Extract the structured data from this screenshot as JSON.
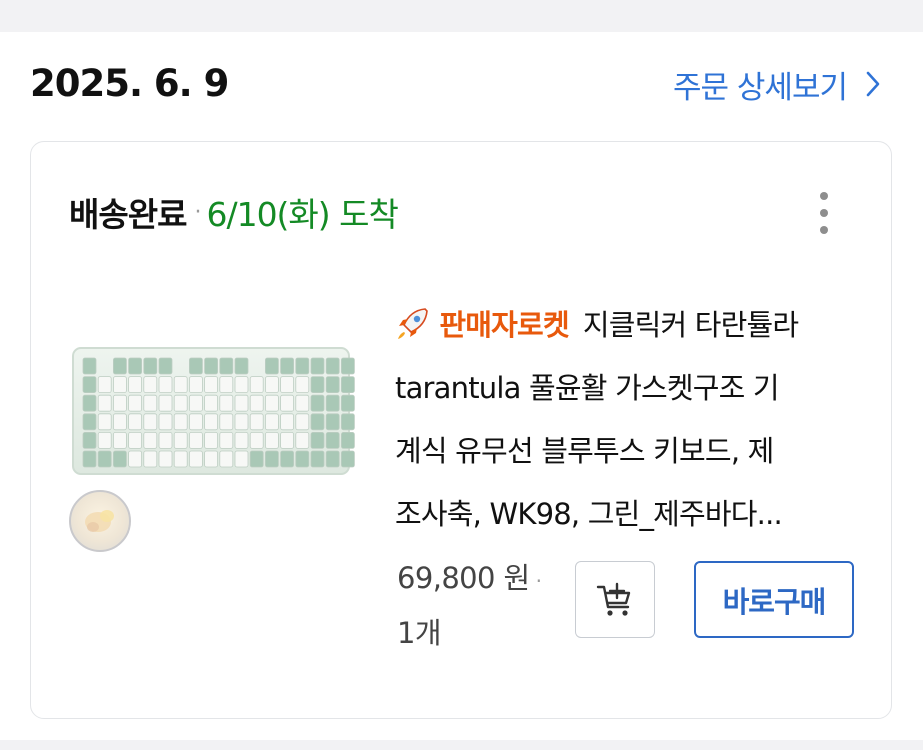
{
  "order": {
    "date": "2025. 6. 9",
    "detail_link_label": "주문 상세보기"
  },
  "delivery": {
    "status_label": "배송완료",
    "separator": "·",
    "arrival_text": "6/10(화) 도착"
  },
  "product": {
    "seller_badge": "판매자로켓",
    "title_lines": [
      "지클릭커 타란튤라",
      "tarantula 풀윤활 가스켓구조 기",
      "계식 유무선 블루투스 키보드, 제",
      "조사축, WK98, 그린_제주바다..."
    ],
    "price": "69,800 원",
    "price_separator": "·",
    "quantity": "1개",
    "image_icon": "keyboard-product-image",
    "gift_icon": "gift-badge-icon"
  },
  "actions": {
    "buy_now_label": "바로구매",
    "cart_icon": "add-to-cart-icon",
    "more_icon": "more-vertical-icon",
    "chevron_icon": "chevron-right-icon"
  },
  "colors": {
    "link_blue": "#2f73d6",
    "arrival_green": "#148a25",
    "rocket_orange": "#e8590c",
    "button_blue": "#2d68c4"
  }
}
